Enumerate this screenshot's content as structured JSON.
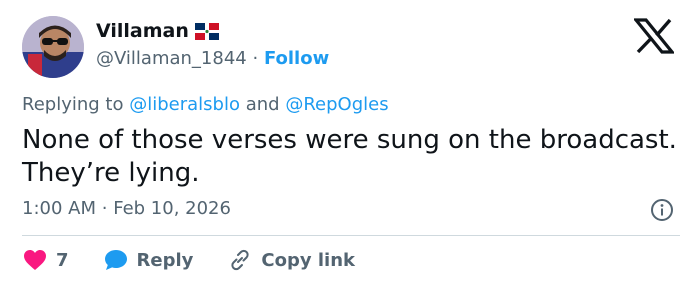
{
  "author": {
    "display_name": "Villaman",
    "handle": "@Villaman_1844",
    "separator": "·",
    "follow_label": "Follow"
  },
  "reply_context": {
    "prefix": "Replying to",
    "mention1": "@liberalsblo",
    "conjunction": "and",
    "mention2": "@RepOgles"
  },
  "tweet": {
    "text": "None of those verses were sung on the broadcast. They’re lying.",
    "time": "1:00 AM",
    "separator": "·",
    "date": "Feb 10, 2026"
  },
  "actions": {
    "like_count": "7",
    "reply_label": "Reply",
    "copy_label": "Copy link"
  },
  "colors": {
    "accent": "#1d9bf0",
    "like": "#f91880",
    "secondary_text": "#536471",
    "primary_text": "#0f1419"
  },
  "icons": {
    "brand": "x-logo-icon",
    "flag": "dominican-flag-icon",
    "info": "info-icon",
    "like": "heart-icon",
    "reply": "speech-bubble-icon",
    "copy": "link-icon"
  }
}
